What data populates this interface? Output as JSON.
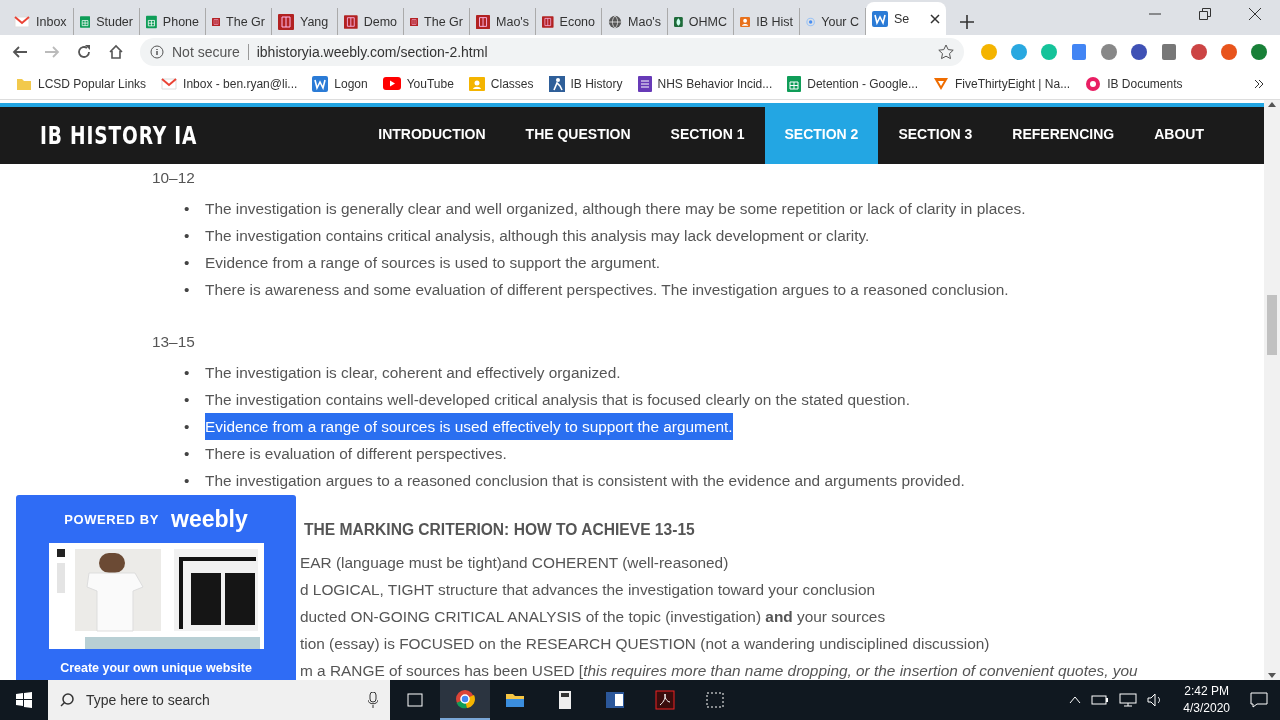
{
  "browser": {
    "tabs": [
      {
        "label": "Inbox",
        "selected": false
      },
      {
        "label": "Studer",
        "selected": false
      },
      {
        "label": "Phone",
        "selected": false
      },
      {
        "label": "The Gr",
        "selected": false
      },
      {
        "label": "Yang",
        "selected": false
      },
      {
        "label": "Demo",
        "selected": false
      },
      {
        "label": "The Gr",
        "selected": false
      },
      {
        "label": "Mao's",
        "selected": false
      },
      {
        "label": "Econo",
        "selected": false
      },
      {
        "label": "Mao's",
        "selected": false
      },
      {
        "label": "OHMC",
        "selected": false
      },
      {
        "label": "IB Hist",
        "selected": false
      },
      {
        "label": "Your C",
        "selected": false
      },
      {
        "label": "Se",
        "selected": true
      }
    ],
    "address": {
      "security": "Not secure",
      "url": "ibhistoryia.weebly.com/section-2.html"
    },
    "bookmarks": [
      {
        "label": "LCSD Popular Links"
      },
      {
        "label": "Inbox - ben.ryan@li..."
      },
      {
        "label": "Logon"
      },
      {
        "label": "YouTube"
      },
      {
        "label": "Classes"
      },
      {
        "label": "IB History"
      },
      {
        "label": "NHS Behavior Incid..."
      },
      {
        "label": "Detention - Google..."
      },
      {
        "label": "FiveThirtyEight | Na..."
      },
      {
        "label": "IB Documents"
      }
    ]
  },
  "site": {
    "title": "IB HISTORY IA",
    "nav": [
      {
        "label": "INTRODUCTION",
        "selected": false
      },
      {
        "label": "THE QUESTION",
        "selected": false
      },
      {
        "label": "SECTION 1",
        "selected": false
      },
      {
        "label": "SECTION 2",
        "selected": true
      },
      {
        "label": "SECTION 3",
        "selected": false
      },
      {
        "label": "REFERENCING",
        "selected": false
      },
      {
        "label": "ABOUT",
        "selected": false
      }
    ],
    "sections": [
      {
        "heading": "10–12",
        "bullets": [
          {
            "marker": "•",
            "text": "The investigation is generally clear and well organized, although there may be some repetition or lack of clarity in places.",
            "highlighted": false
          },
          {
            "marker": "•",
            "text": "The investigation contains critical analysis, although this analysis may lack development or clarity.",
            "highlighted": false
          },
          {
            "marker": "•",
            "text": "Evidence from a range of sources is used to support the argument.",
            "highlighted": false
          },
          {
            "marker": "•",
            "text": "There is awareness and some evaluation of different perspectives. The investigation argues to a reasoned conclusion.",
            "highlighted": false
          }
        ]
      },
      {
        "heading": "13–15",
        "bullets": [
          {
            "marker": "•",
            "text": "The investigation is clear, coherent and effectively organized.",
            "highlighted": false
          },
          {
            "marker": "•",
            "text": "The investigation contains well-developed critical analysis that is focused clearly on the stated question.",
            "highlighted": false
          },
          {
            "marker": "•",
            "text": "Evidence from a range of sources is used effectively to support the argument.",
            "highlighted": true
          },
          {
            "marker": "•",
            "text": "There is evaluation of different perspectives.",
            "highlighted": false
          },
          {
            "marker": "•",
            "text": "The investigation argues to a reasoned conclusion that is consistent with the evidence and arguments provided.",
            "highlighted": false
          }
        ]
      }
    ],
    "criterion": {
      "heading": "THE MARKING CRITERION: HOW TO ACHIEVE 13-15",
      "lines": [
        "EAR (language must be tight)and COHERENT (well-reasoned)",
        "d LOGICAL, TIGHT structure that advances the investigation toward your conclusion",
        "ducted ON-GOING CRITICAL ANALYSIS of the topic (investigation) **and** your sources",
        "tion (essay) is FOCUSED on the RESEARCH QUESTION (not a wandering undisciplined discussion)",
        "m a RANGE of sources has been USED [*this requires more than name dropping, or the insertion of convenient quotes, you*"
      ]
    },
    "popup": {
      "powered_by": "POWERED BY",
      "brand": "weebly",
      "cta": "Create your own unique website"
    }
  },
  "taskbar": {
    "search": {
      "placeholder": "Type here to search"
    },
    "time": "2:42 PM",
    "date": "4/3/2020"
  }
}
